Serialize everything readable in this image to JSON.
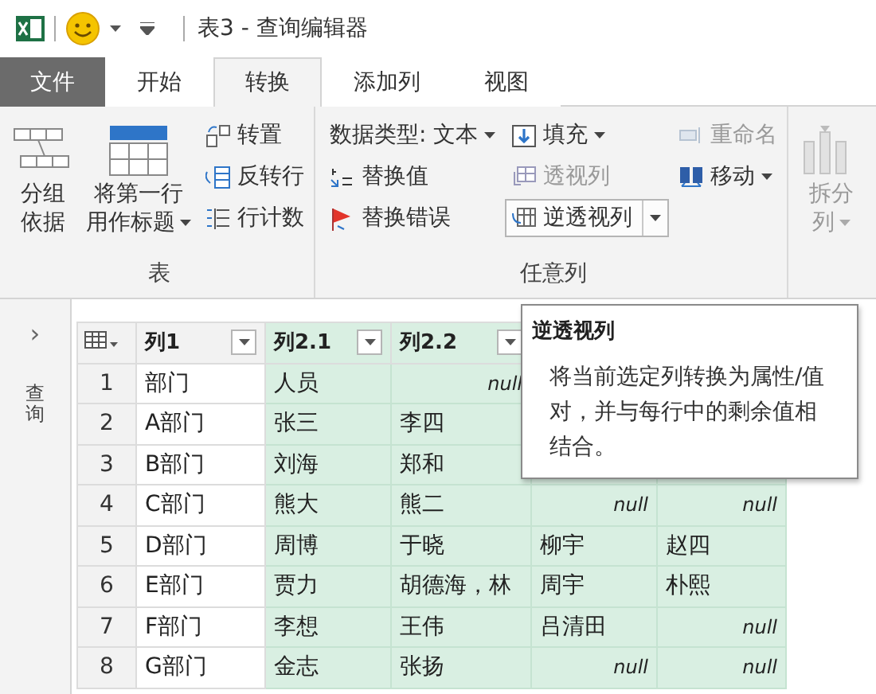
{
  "window": {
    "title": "表3 - 查询编辑器"
  },
  "tabs": [
    {
      "label": "文件",
      "kind": "file",
      "selected": false
    },
    {
      "label": "开始",
      "kind": "tab",
      "selected": false
    },
    {
      "label": "转换",
      "kind": "tab",
      "selected": true
    },
    {
      "label": "添加列",
      "kind": "tab",
      "selected": false
    },
    {
      "label": "视图",
      "kind": "tab",
      "selected": false
    }
  ],
  "ribbon": {
    "groups": [
      {
        "label": "表",
        "items": [
          {
            "kind": "large",
            "lines": [
              "分组",
              "依据"
            ],
            "dropdown": false,
            "disabled": false
          },
          {
            "kind": "large",
            "lines": [
              "将第一行",
              "用作标题"
            ],
            "dropdown": true,
            "disabled": false
          },
          {
            "kind": "stack",
            "items": [
              {
                "label": "转置",
                "dropdown": false,
                "disabled": false,
                "hovered": false
              },
              {
                "label": "反转行",
                "dropdown": false,
                "disabled": false,
                "hovered": false
              },
              {
                "label": "行计数",
                "dropdown": false,
                "disabled": false,
                "hovered": false
              }
            ]
          }
        ]
      },
      {
        "label": "任意列",
        "items": [
          {
            "kind": "stack",
            "items": [
              {
                "label": "数据类型: 文本",
                "dropdown": true,
                "disabled": false,
                "hovered": false
              },
              {
                "label": "替换值",
                "dropdown": false,
                "disabled": false,
                "hovered": false
              },
              {
                "label": "替换错误",
                "dropdown": false,
                "disabled": false,
                "hovered": false
              }
            ]
          },
          {
            "kind": "stack",
            "items": [
              {
                "label": "填充",
                "dropdown": true,
                "disabled": false,
                "hovered": false
              },
              {
                "label": "透视列",
                "dropdown": false,
                "disabled": true,
                "hovered": false
              },
              {
                "label": "逆透视列",
                "dropdown": true,
                "disabled": false,
                "hovered": true
              }
            ]
          },
          {
            "kind": "stack",
            "items": [
              {
                "label": "重命名",
                "dropdown": false,
                "disabled": true,
                "hovered": false
              },
              {
                "label": "移动",
                "dropdown": true,
                "disabled": false,
                "hovered": false
              }
            ]
          }
        ]
      },
      {
        "items": [
          {
            "kind": "large",
            "lines": [
              "拆分",
              "列"
            ],
            "dropdown": true,
            "disabled": true
          }
        ]
      }
    ]
  },
  "sidebar": {
    "toggle": "›",
    "label": "查询"
  },
  "table": {
    "columns": [
      {
        "label": "列1",
        "selected": false
      },
      {
        "label": "列2.1",
        "selected": true
      },
      {
        "label": "列2.2",
        "selected": true
      },
      {
        "selected": true
      },
      {
        "selected": true
      }
    ],
    "rows": [
      {
        "index": "1",
        "cells": [
          {
            "text": "部门",
            "kind": "text"
          },
          {
            "text": "人员",
            "kind": "text"
          },
          {
            "text": "null",
            "kind": "null"
          }
        ]
      },
      {
        "index": "2",
        "cells": [
          {
            "text": "A部门",
            "kind": "text"
          },
          {
            "text": "张三",
            "kind": "text"
          },
          {
            "text": "李四",
            "kind": "text"
          }
        ]
      },
      {
        "index": "3",
        "cells": [
          {
            "text": "B部门",
            "kind": "text"
          },
          {
            "text": "刘海",
            "kind": "text"
          },
          {
            "text": "郑和",
            "kind": "text"
          }
        ]
      },
      {
        "index": "4",
        "cells": [
          {
            "text": "C部门",
            "kind": "text"
          },
          {
            "text": "熊大",
            "kind": "text"
          },
          {
            "text": "熊二",
            "kind": "text"
          },
          {
            "text": "null",
            "kind": "null"
          },
          {
            "text": "null",
            "kind": "null"
          }
        ]
      },
      {
        "index": "5",
        "cells": [
          {
            "text": "D部门",
            "kind": "text"
          },
          {
            "text": "周博",
            "kind": "text"
          },
          {
            "text": "于晓",
            "kind": "text"
          },
          {
            "text": "柳宇",
            "kind": "text"
          },
          {
            "text": "赵四",
            "kind": "text"
          }
        ]
      },
      {
        "index": "6",
        "cells": [
          {
            "text": "E部门",
            "kind": "text"
          },
          {
            "text": "贾力",
            "kind": "text"
          },
          {
            "text": "胡德海，林",
            "kind": "text"
          },
          {
            "text": "周宇",
            "kind": "text"
          },
          {
            "text": "朴熙",
            "kind": "text"
          }
        ]
      },
      {
        "index": "7",
        "cells": [
          {
            "text": "F部门",
            "kind": "text"
          },
          {
            "text": "李想",
            "kind": "text"
          },
          {
            "text": "王伟",
            "kind": "text"
          },
          {
            "text": "吕清田",
            "kind": "text"
          },
          {
            "text": "null",
            "kind": "null"
          }
        ]
      },
      {
        "index": "8",
        "cells": [
          {
            "text": "G部门",
            "kind": "text"
          },
          {
            "text": "金志",
            "kind": "text"
          },
          {
            "text": "张扬",
            "kind": "text"
          },
          {
            "text": "null",
            "kind": "null"
          },
          {
            "text": "null",
            "kind": "null"
          }
        ]
      }
    ]
  },
  "tooltip": {
    "title": "逆透视列",
    "text": "将当前选定列转换为属性/值对，并与每行中的剩余值相结合。"
  }
}
